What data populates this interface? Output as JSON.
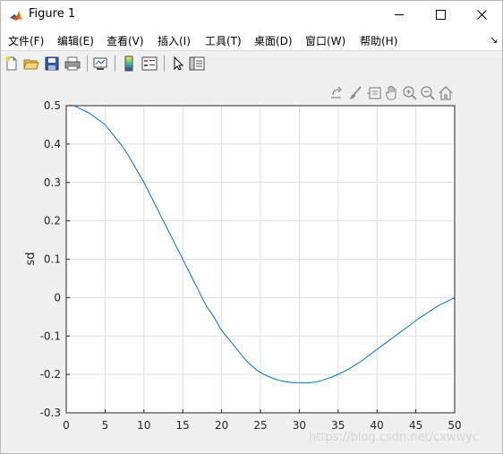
{
  "window": {
    "title": "Figure 1"
  },
  "menu": {
    "items": [
      {
        "label": "文件(F)"
      },
      {
        "label": "编辑(E)"
      },
      {
        "label": "查看(V)"
      },
      {
        "label": "插入(I)"
      },
      {
        "label": "工具(T)"
      },
      {
        "label": "桌面(D)"
      },
      {
        "label": "窗口(W)"
      },
      {
        "label": "帮助(H)"
      }
    ],
    "overflow_icon": "dock-arrow-icon"
  },
  "toolbar": {
    "buttons": [
      "new-figure-icon",
      "open-file-icon",
      "save-icon",
      "print-icon",
      "link-plot-icon",
      "colorbar-icon",
      "legend-icon",
      "pointer-icon",
      "property-inspector-icon"
    ]
  },
  "axes_toolbar": {
    "buttons": [
      "export-icon",
      "brush-icon",
      "datatip-icon",
      "pan-icon",
      "zoom-in-icon",
      "zoom-out-icon",
      "home-icon"
    ]
  },
  "chart_data": {
    "type": "line",
    "title": "",
    "xlabel": "",
    "ylabel": "sd",
    "xlim": [
      0,
      50
    ],
    "ylim": [
      -0.3,
      0.5
    ],
    "xticks": [
      "0",
      "5",
      "10",
      "15",
      "20",
      "25",
      "30",
      "35",
      "40",
      "45",
      "50"
    ],
    "yticks": [
      "0.5",
      "0.4",
      "0.3",
      "0.2",
      "0.1",
      "0",
      "-0.1",
      "-0.2",
      "-0.3"
    ],
    "grid": true,
    "line_color": "#0072bd",
    "series": [
      {
        "x": [
          0,
          1,
          2,
          3,
          4,
          5,
          6,
          7,
          8,
          9,
          10,
          11,
          12,
          13,
          14,
          15,
          16,
          17,
          18,
          19,
          20,
          21,
          22,
          23,
          24,
          25,
          26,
          27,
          28,
          29,
          30,
          31,
          32,
          33,
          34,
          35,
          36,
          37,
          38,
          39,
          40,
          41,
          42,
          43,
          44,
          45,
          46,
          47,
          48,
          49,
          50
        ],
        "values": [
          0.5,
          0.5,
          0.49,
          0.48,
          0.465,
          0.45,
          0.425,
          0.4,
          0.37,
          0.335,
          0.3,
          0.26,
          0.22,
          0.18,
          0.14,
          0.1,
          0.06,
          0.02,
          -0.02,
          -0.05,
          -0.085,
          -0.11,
          -0.135,
          -0.16,
          -0.18,
          -0.195,
          -0.205,
          -0.213,
          -0.218,
          -0.221,
          -0.222,
          -0.222,
          -0.22,
          -0.215,
          -0.208,
          -0.2,
          -0.19,
          -0.178,
          -0.165,
          -0.15,
          -0.135,
          -0.12,
          -0.105,
          -0.09,
          -0.075,
          -0.06,
          -0.046,
          -0.033,
          -0.02,
          -0.01,
          0.0
        ]
      }
    ]
  },
  "watermark": "https://blog.csdn.net/cxwwyc"
}
